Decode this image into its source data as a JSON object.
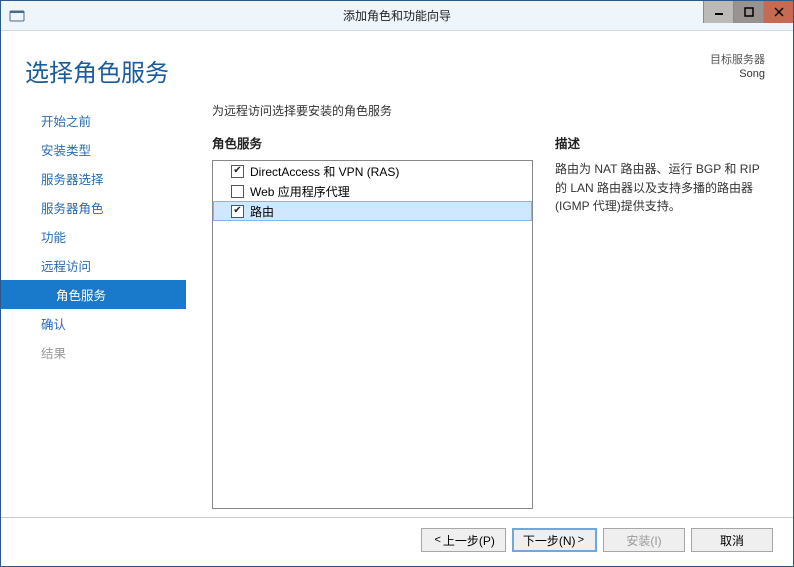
{
  "window": {
    "title": "添加角色和功能向导"
  },
  "header": {
    "page_title": "选择角色服务",
    "target_label": "目标服务器",
    "target_name": "Song"
  },
  "nav": {
    "items": [
      {
        "label": "开始之前",
        "selected": false,
        "disabled": false,
        "sub": false
      },
      {
        "label": "安装类型",
        "selected": false,
        "disabled": false,
        "sub": false
      },
      {
        "label": "服务器选择",
        "selected": false,
        "disabled": false,
        "sub": false
      },
      {
        "label": "服务器角色",
        "selected": false,
        "disabled": false,
        "sub": false
      },
      {
        "label": "功能",
        "selected": false,
        "disabled": false,
        "sub": false
      },
      {
        "label": "远程访问",
        "selected": false,
        "disabled": false,
        "sub": false
      },
      {
        "label": "角色服务",
        "selected": true,
        "disabled": false,
        "sub": true
      },
      {
        "label": "确认",
        "selected": false,
        "disabled": false,
        "sub": false
      },
      {
        "label": "结果",
        "selected": false,
        "disabled": true,
        "sub": false
      }
    ]
  },
  "main": {
    "instruction": "为远程访问选择要安装的角色服务",
    "list_heading": "角色服务",
    "desc_heading": "描述",
    "description": "路由为 NAT 路由器、运行 BGP 和 RIP 的 LAN 路由器以及支持多播的路由器(IGMP 代理)提供支持。",
    "items": [
      {
        "label": "DirectAccess 和 VPN (RAS)",
        "checked": true,
        "selected": false
      },
      {
        "label": "Web 应用程序代理",
        "checked": false,
        "selected": false
      },
      {
        "label": "路由",
        "checked": true,
        "selected": true
      }
    ]
  },
  "footer": {
    "prev": "上一步(P)",
    "next": "下一步(N)",
    "install": "安装(I)",
    "cancel": "取消"
  }
}
